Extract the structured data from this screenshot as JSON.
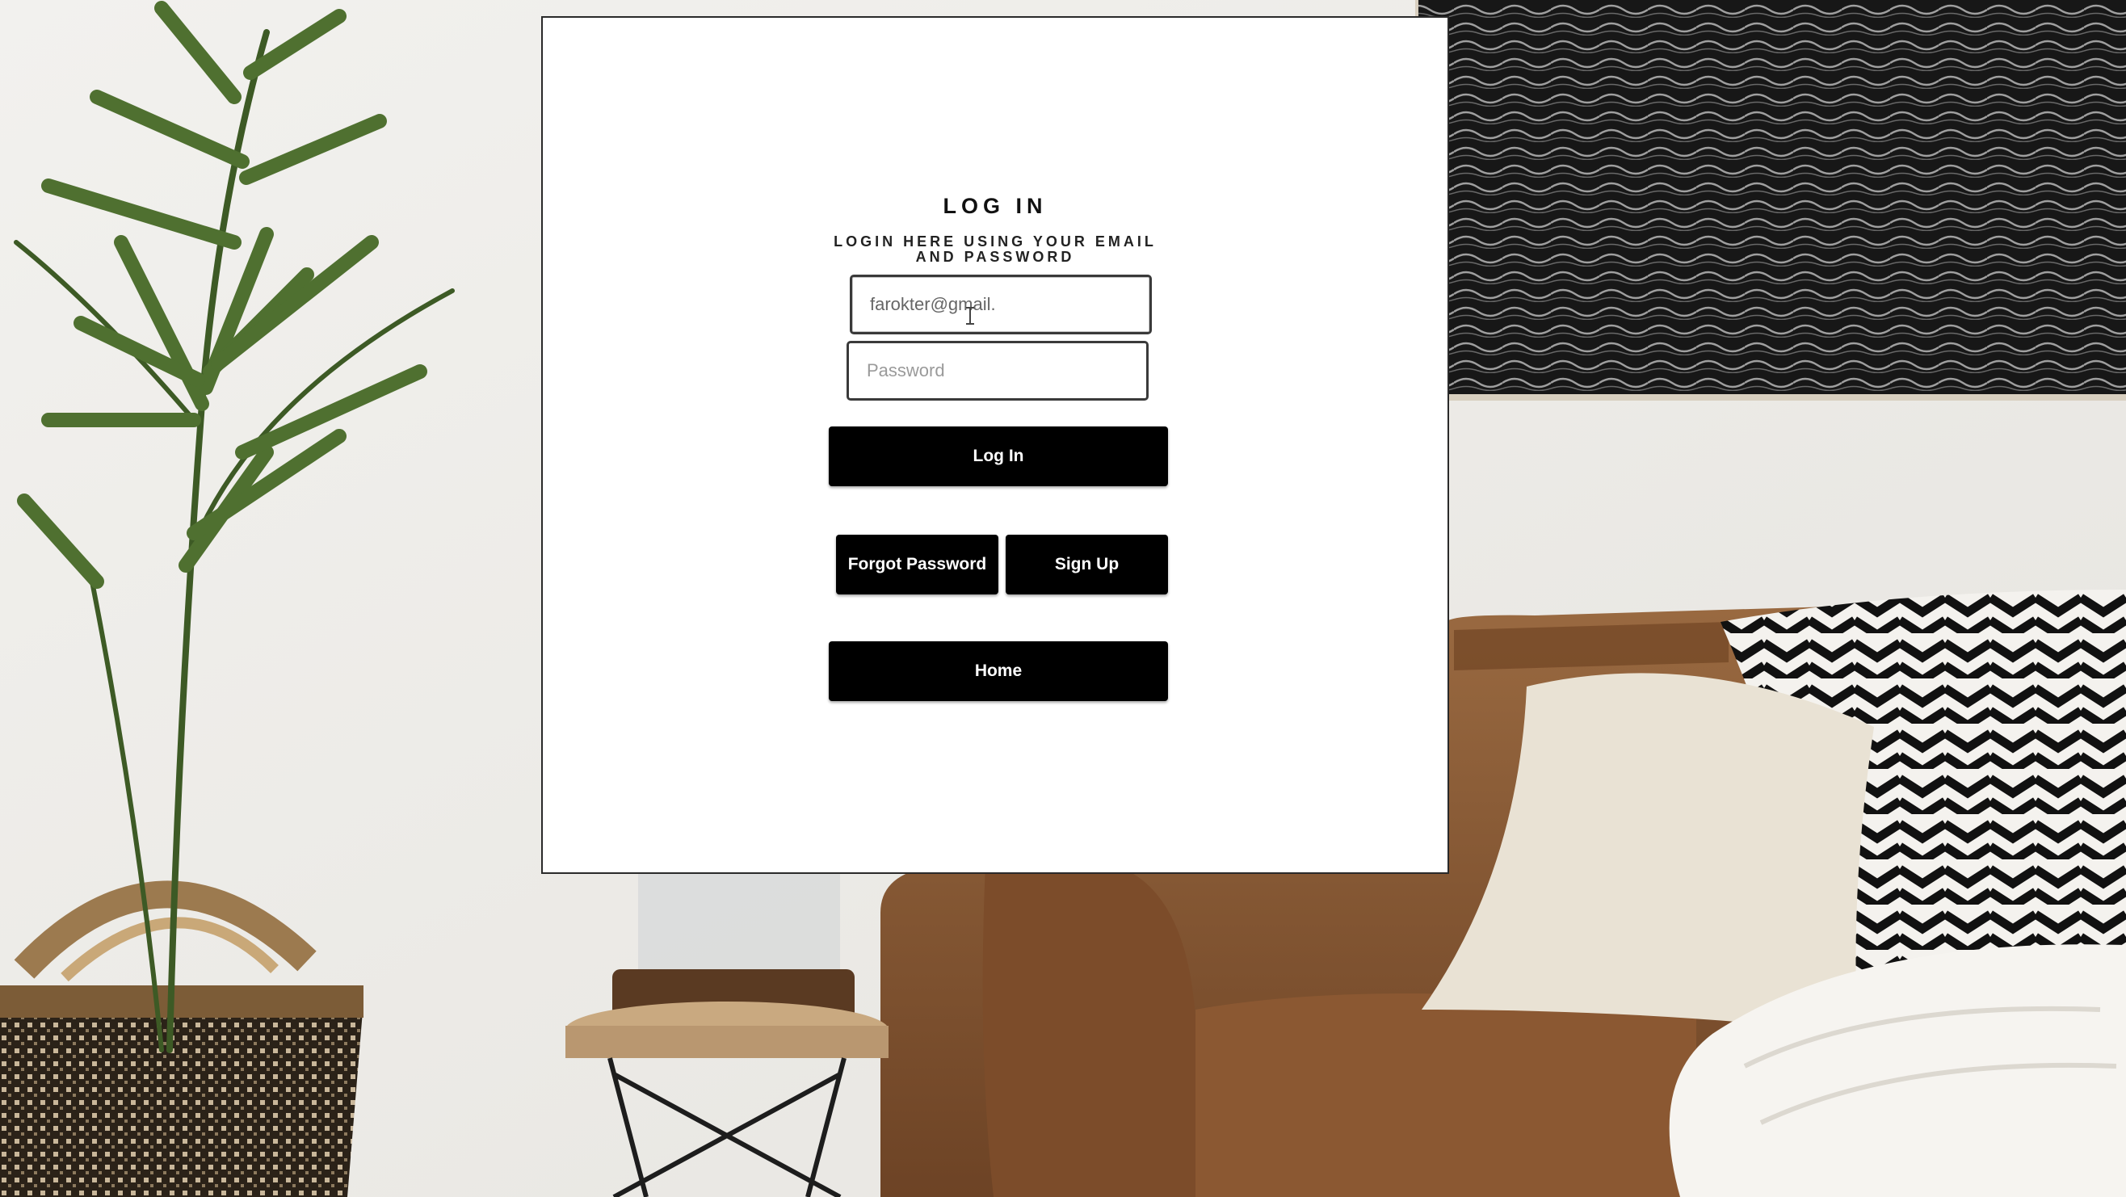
{
  "login": {
    "title": "LOG IN",
    "subtitle": "LOGIN HERE USING YOUR EMAIL AND PASSWORD",
    "email_value": "farokter@gmail.",
    "password_placeholder": "Password",
    "login_button": "Log In",
    "forgot_button": "Forgot Password",
    "signup_button": "Sign Up",
    "home_button": "Home"
  },
  "colors": {
    "card": "#ffffff",
    "button": "#000000",
    "button_text": "#ffffff",
    "sofa": "#8a5a34",
    "wall": "#eeeeec"
  },
  "background_icons": [
    "palm-plant",
    "ocean-wave-artwork",
    "leather-sofa",
    "cream-cushion",
    "chevron-pattern-pillow",
    "side-table-lantern",
    "woven-basket",
    "white-throw-blanket"
  ]
}
